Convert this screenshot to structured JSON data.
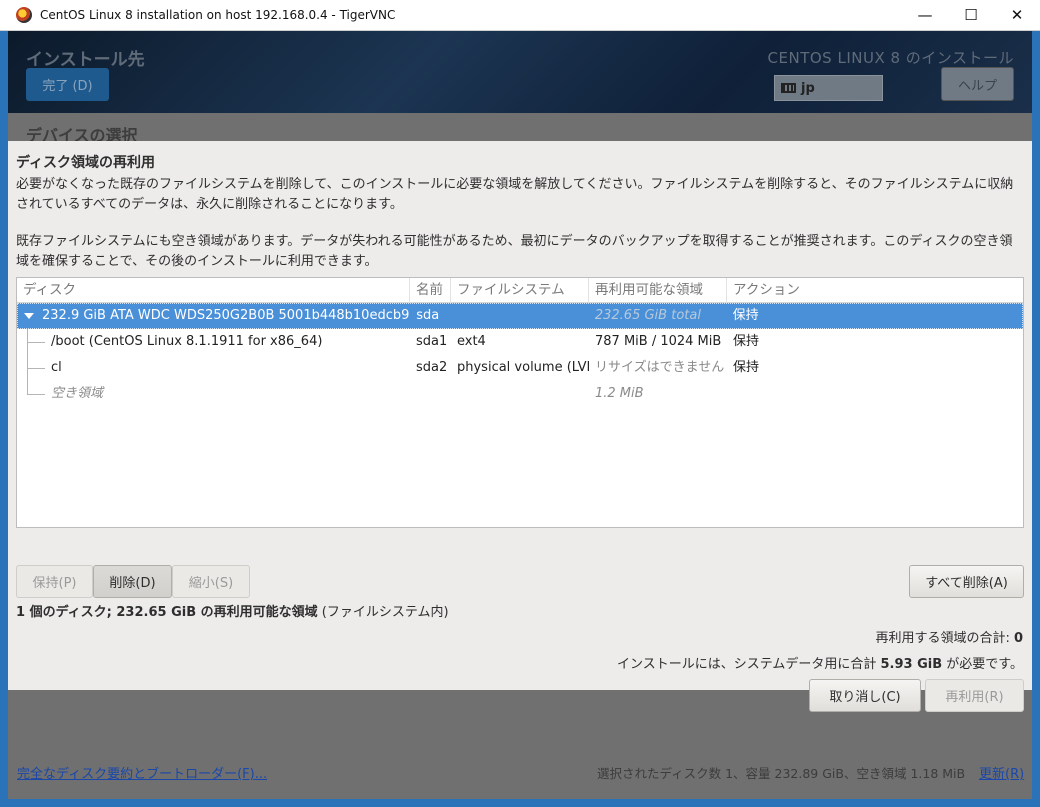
{
  "window": {
    "title": "CentOS Linux 8 installation on host 192.168.0.4 - TigerVNC",
    "minimize": "—",
    "maximize": "☐",
    "close": "✕"
  },
  "installer": {
    "spoke_title": "インストール先",
    "done_button": "完了 (D)",
    "product_title": "CENTOS LINUX 8 のインストール",
    "keyboard_layout": "jp",
    "help_button": "ヘルプ",
    "section_title": "デバイスの選択",
    "footer_link": "完全なディスク要約とブートローダー(F)...",
    "footer_status": "選択されたディスク数 1、容量 232.89 GiB、空き領域 1.18 MiB",
    "footer_refresh": "更新(R)"
  },
  "dialog": {
    "heading": "ディスク領域の再利用",
    "para1": "必要がなくなった既存のファイルシステムを削除して、このインストールに必要な領域を解放してください。ファイルシステムを削除すると、そのファイルシステムに収納されているすべてのデータは、永久に削除されることになります。",
    "para2": "既存ファイルシステムにも空き領域があります。データが失われる可能性があるため、最初にデータのバックアップを取得することが推奨されます。このディスクの空き領域を確保することで、その後のインストールに利用できます。",
    "columns": [
      "ディスク",
      "名前",
      "ファイルシステム",
      "再利用可能な領域",
      "アクション"
    ],
    "rows": [
      {
        "disk": "232.9 GiB ATA WDC  WDS250G2B0B 5001b448b10edcb9",
        "name": "sda",
        "fs": "",
        "reclaimable": "232.65 GiB total",
        "action": "保持"
      },
      {
        "disk": "/boot (CentOS Linux 8.1.1911 for x86_64)",
        "name": "sda1",
        "fs": "ext4",
        "reclaimable": "787 MiB / 1024 MiB",
        "action": "保持"
      },
      {
        "disk": "cl",
        "name": "sda2",
        "fs": "physical volume (LVM)",
        "reclaimable": "リサイズはできません",
        "action": "保持"
      },
      {
        "disk": "空き領域",
        "name": "",
        "fs": "",
        "reclaimable": "1.2 MiB",
        "action": ""
      }
    ],
    "buttons": {
      "preserve": "保持(P)",
      "delete": "削除(D)",
      "shrink": "縮小(S)",
      "delete_all": "すべて削除(A)",
      "cancel": "取り消し(C)",
      "reclaim": "再利用(R)"
    },
    "summary_bold": "1 個のディスク; 232.65 GiB の再利用可能な領域",
    "summary_rest": " (ファイルシステム内)",
    "reclaim_total_label": "再利用する領域の合計: ",
    "reclaim_total_value": "0",
    "required_prefix": "インストールには、システムデータ用に合計 ",
    "required_value": "5.93 GiB",
    "required_suffix": " が必要です。"
  }
}
